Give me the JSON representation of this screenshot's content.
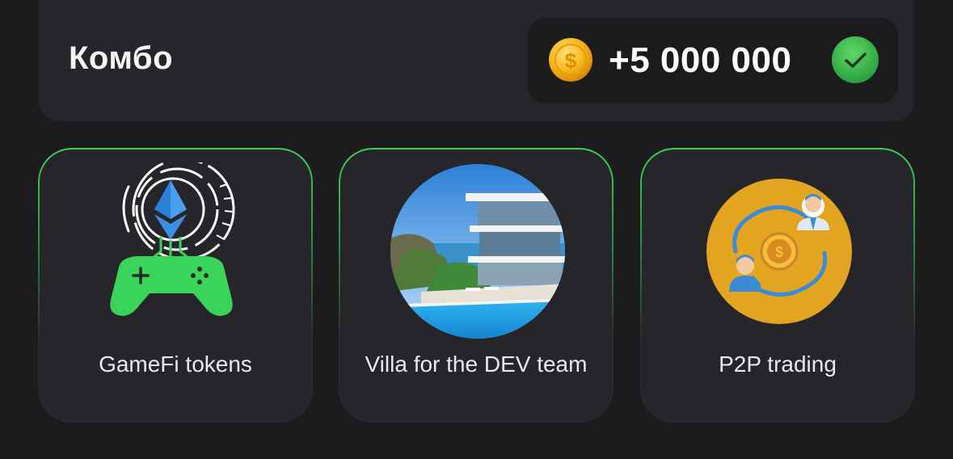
{
  "combo": {
    "title": "Комбо",
    "reward": "+5 000 000",
    "status": "completed"
  },
  "colors": {
    "accent_green": "#3bd45a",
    "coin_gold": "#f4b400",
    "card_bg": "#26262a",
    "page_bg": "#1c1c1f"
  },
  "cards": [
    {
      "label": "GameFi tokens",
      "icon": "gamepad-ethereum-icon"
    },
    {
      "label": "Villa for the DEV team",
      "icon": "villa-image"
    },
    {
      "label": "P2P trading",
      "icon": "p2p-exchange-icon"
    }
  ]
}
